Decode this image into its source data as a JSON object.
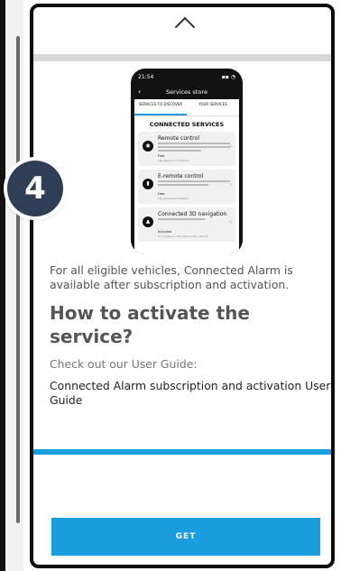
{
  "step": {
    "number": "4"
  },
  "top_bar": {
    "icon": "chevron-up-icon"
  },
  "mock_phone": {
    "time": "21:54",
    "header_title": "Services store",
    "back_icon": "chevron-left-icon",
    "tabs": [
      {
        "label": "SERVICES TO DISCOVER",
        "active": true
      },
      {
        "label": "YOUR SERVICES",
        "active": false
      }
    ],
    "section_title": "CONNECTED SERVICES",
    "cards": [
      {
        "title": "Remote control",
        "icon": "remote-icon",
        "price": "Free",
        "note": "see general conditions"
      },
      {
        "title": "E-remote control",
        "icon": "plug-icon",
        "price": "Free",
        "note": "see general conditions"
      },
      {
        "title": "Connected 3D navigation",
        "icon": "navigation-icon",
        "price": "Included",
        "note": "for 3 years in the price of the vehicle"
      }
    ]
  },
  "content": {
    "intro": "For all eligible vehicles, Connected Alarm is available after subscription and activation.",
    "heading": "How to activate the service?",
    "guide_intro": "Check out our User Guide:",
    "guide_link": "Connected Alarm subscription and activation User Guide"
  },
  "cta": {
    "label": "GET"
  },
  "colors": {
    "accent": "#1a9ddf",
    "badge": "#2f3e55"
  }
}
